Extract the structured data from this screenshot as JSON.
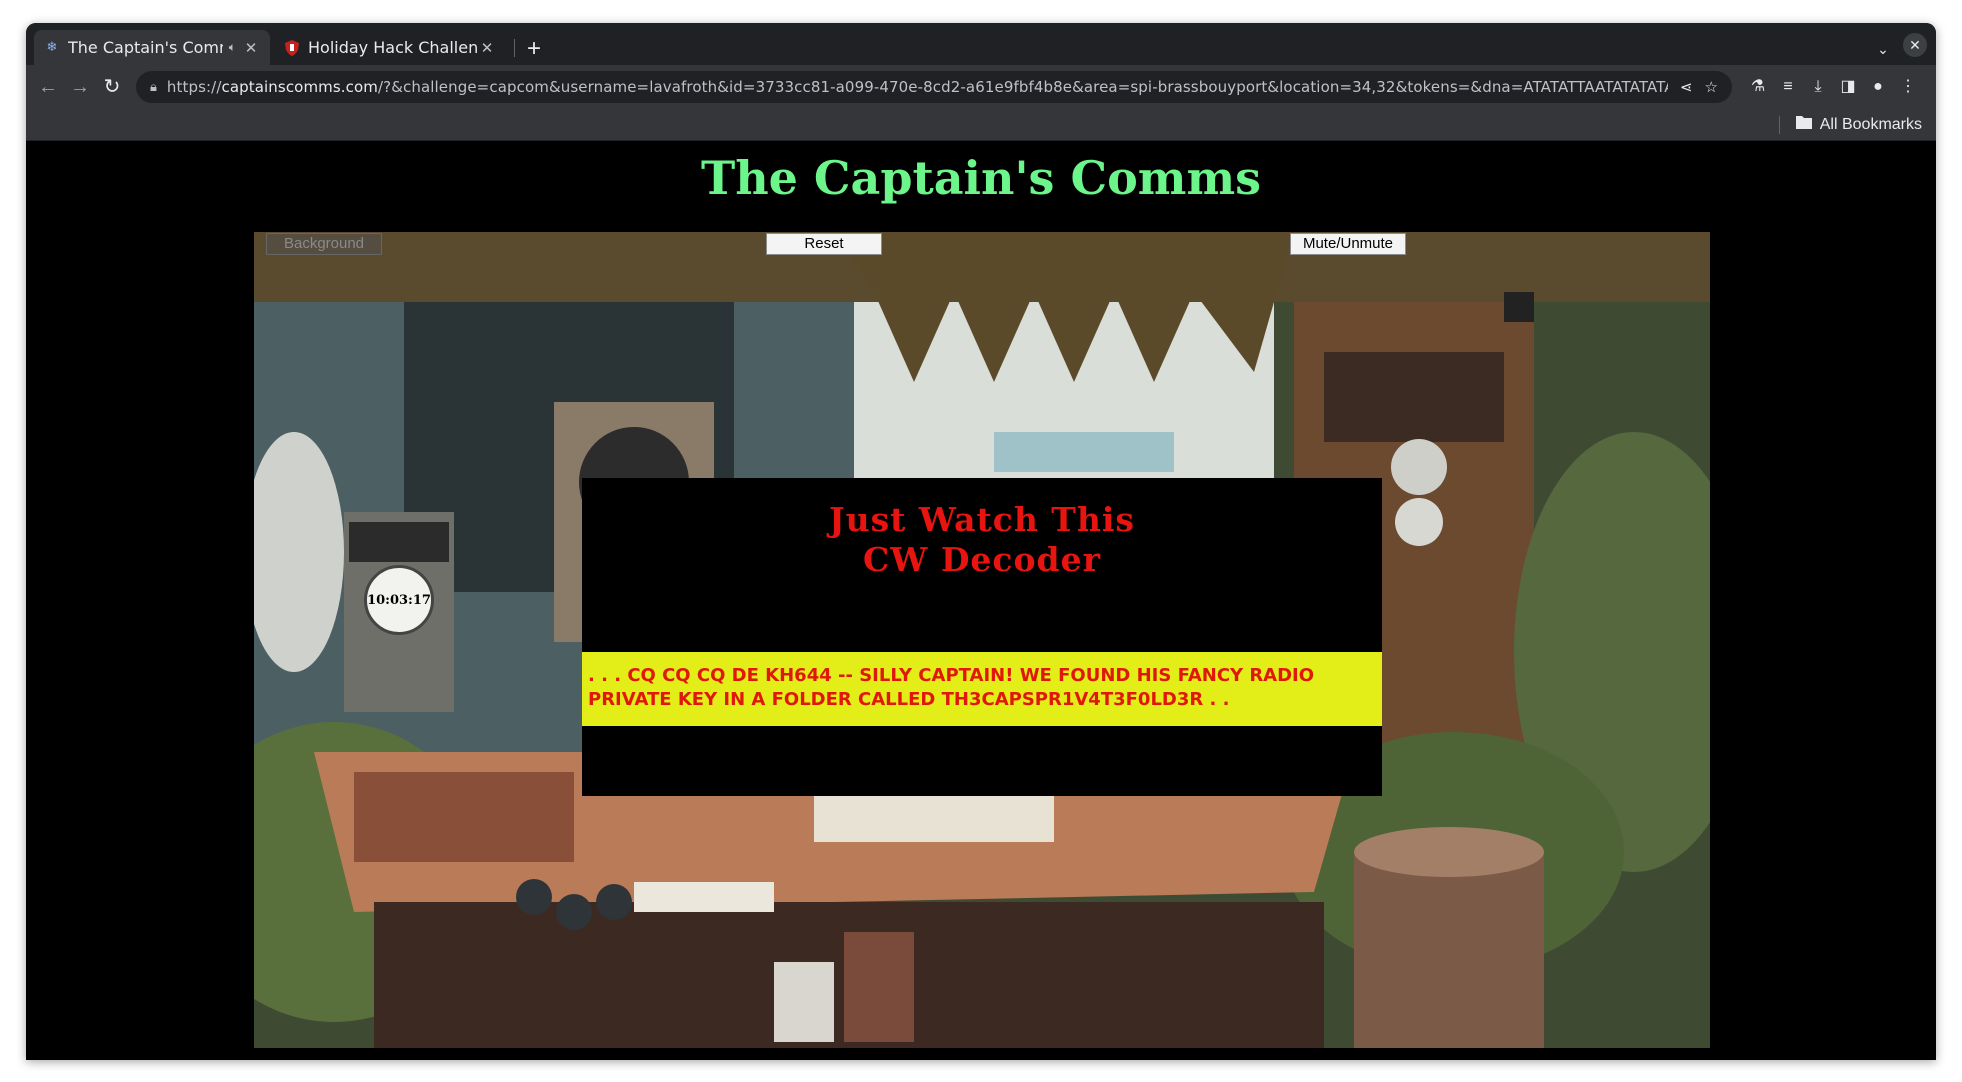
{
  "browser": {
    "tabs": [
      {
        "title": "The Captain's Comms",
        "active": true,
        "icon": "snowflake-icon",
        "audio": true
      },
      {
        "title": "Holiday Hack Challenge",
        "active": false,
        "icon": "shield-icon",
        "audio": false
      }
    ],
    "url": {
      "prefix": "https://",
      "host": "captainscomms.com",
      "path": "/?&challenge=capcom&username=lavafroth&id=3733cc81-a099-470e-8cd2-a61e9fbf4b8e&area=spi-brassbouyport&location=34,32&tokens=&dna=ATATATTAATATATATATATATCGAT..."
    },
    "bookmarks": {
      "all_label": "All Bookmarks"
    }
  },
  "page": {
    "title": "The Captain's Comms",
    "buttons": {
      "background": "Background",
      "reset": "Reset",
      "mute": "Mute/Unmute"
    },
    "clock": "10:03:17",
    "decoder": {
      "title_line1": "Just Watch This",
      "title_line2": "CW Decoder",
      "output": ". . . CQ CQ CQ DE KH644 -- SILLY CAPTAIN! WE FOUND HIS FANCY RADIO\nPRIVATE KEY IN A FOLDER CALLED TH3CAPSPR1V4T3F0LD3R . ."
    }
  },
  "colors": {
    "title_green": "#6cf58a",
    "decoder_red": "#e8140f",
    "output_yellow": "#e3ed17"
  }
}
